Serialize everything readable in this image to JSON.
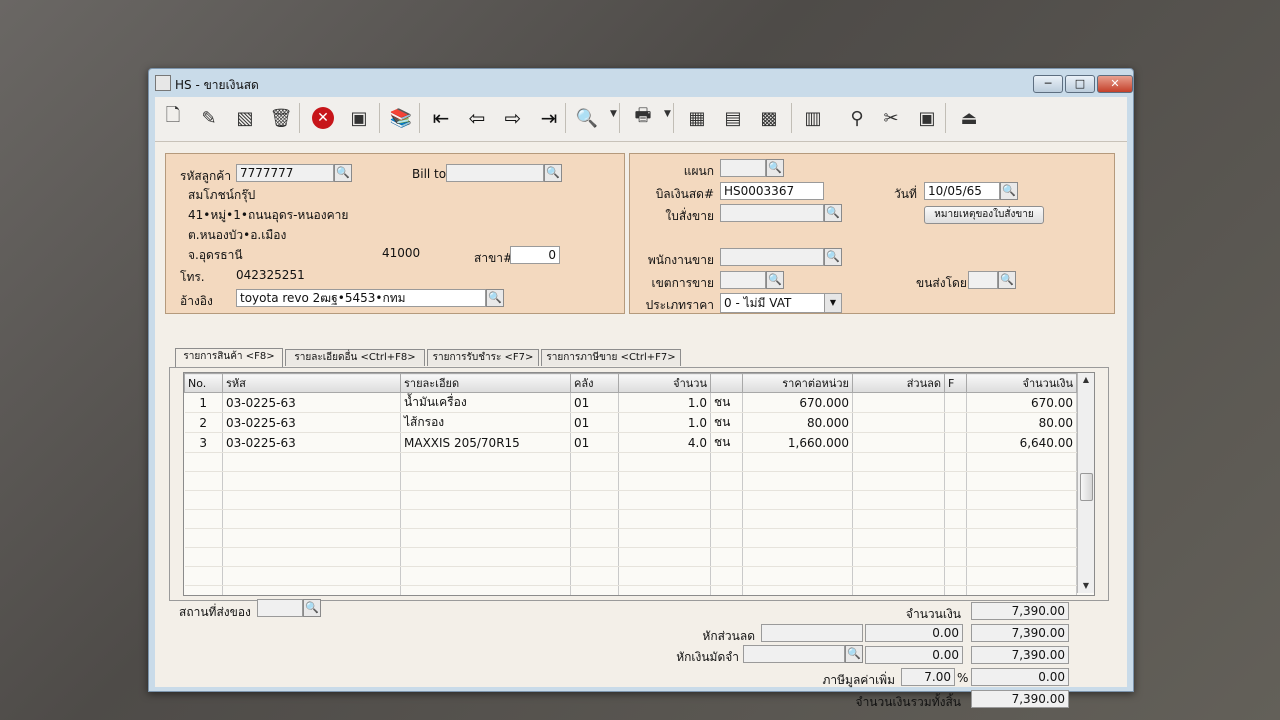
{
  "window": {
    "title": "HS - ขายเงินสด",
    "min_label": "─",
    "max_label": "□",
    "close_label": "✕"
  },
  "toolbar": {
    "buttons": [
      {
        "name": "new-icon",
        "glyph": "🗋"
      },
      {
        "name": "edit-icon",
        "glyph": "✎"
      },
      {
        "name": "cancel-doc-icon",
        "glyph": "▧"
      },
      {
        "name": "delete-icon",
        "glyph": "🗑"
      },
      {
        "name": "stop-icon",
        "glyph": "✕"
      },
      {
        "name": "save-icon",
        "glyph": "▣"
      },
      {
        "name": "book-icon",
        "glyph": "📚"
      },
      {
        "name": "first-record-icon",
        "glyph": "⇤"
      },
      {
        "name": "previous-record-icon",
        "glyph": "⇦"
      },
      {
        "name": "next-record-icon",
        "glyph": "⇨"
      },
      {
        "name": "last-record-icon",
        "glyph": "⇥"
      },
      {
        "name": "preview-icon",
        "glyph": "🔍"
      },
      {
        "name": "print-icon",
        "glyph": "🖶"
      },
      {
        "name": "calculator-icon",
        "glyph": "▦"
      },
      {
        "name": "report-icon",
        "glyph": "▤"
      },
      {
        "name": "spreadsheet-icon",
        "glyph": "▩"
      },
      {
        "name": "calendar-icon",
        "glyph": "▥"
      },
      {
        "name": "approve-icon",
        "glyph": "⚲"
      },
      {
        "name": "tools-icon",
        "glyph": "✂"
      },
      {
        "name": "ok-icon",
        "glyph": "▣"
      },
      {
        "name": "exit-icon",
        "glyph": "⏏"
      }
    ]
  },
  "customer": {
    "code_label": "รหัสลูกค้า",
    "code": "7777777",
    "bill_to_label": "Bill to",
    "bill_to": "",
    "name": "สมโภชน์กรุ๊ป",
    "address1": "41•หมู่•1•ถนนอุดร-หนองคาย",
    "address2": "ต.หนองบัว•อ.เมือง",
    "province": "จ.อุดรธานี",
    "postcode": "41000",
    "branch_label": "สาขา#",
    "branch": "0",
    "phone_label": "โทร.",
    "phone": "042325251",
    "ref_label": "อ้างอิง",
    "ref": "toyota revo 2ฒฐ•5453•กทม"
  },
  "document": {
    "dept_label": "แผนก",
    "dept": "",
    "bill_label": "บิลเงินสด#",
    "bill": "HS0003367",
    "date_label": "วันที่",
    "date": "10/05/65",
    "so_label": "ใบสั่งขาย",
    "so": "",
    "so_note_button": "หมายเหตุของใบสั่งขาย",
    "salesman_label": "พนักงานขาย",
    "salesman": "",
    "area_label": "เขตการขาย",
    "area": "",
    "ship_by_label": "ขนส่งโดย",
    "ship_by": "",
    "price_type_label": "ประเภทราคา",
    "price_type": "0 - ไม่มี VAT"
  },
  "tabs": [
    {
      "label": "รายการสินค้า <F8>"
    },
    {
      "label": "รายละเอียดอื่น <Ctrl+F8>"
    },
    {
      "label": "รายการรับชำระ <F7>"
    },
    {
      "label": "รายการภาษีขาย <Ctrl+F7>"
    }
  ],
  "grid": {
    "headers": [
      "No.",
      "รหัส",
      "รายละเอียด",
      "คลัง",
      "จำนวน",
      "",
      "ราคาต่อหน่วย",
      "ส่วนลด",
      "F",
      "จำนวนเงิน"
    ],
    "rows": [
      [
        "1",
        "03-0225-63",
        "น้ำมันเครื่อง",
        "01",
        "1.0",
        "ชน",
        "670.000",
        "",
        "",
        "670.00"
      ],
      [
        "2",
        "03-0225-63",
        "ไส้กรอง",
        "01",
        "1.0",
        "ชน",
        "80.000",
        "",
        "",
        "80.00"
      ],
      [
        "3",
        "03-0225-63",
        "MAXXIS 205/70R15",
        "01",
        "4.0",
        "ชน",
        "1,660.000",
        "",
        "",
        "6,640.00"
      ]
    ],
    "empty_rows": 8
  },
  "footer": {
    "ship_place_label": "สถานที่ส่งของ",
    "ship_place": "",
    "amount_label": "จำนวนเงิน",
    "amount": "7,390.00",
    "discount_label": "หักส่วนลด",
    "discount_text": "",
    "discount": "0.00",
    "after_discount": "7,390.00",
    "deposit_label": "หักเงินมัดจำ",
    "deposit_text": "",
    "deposit": "0.00",
    "after_deposit": "7,390.00",
    "vat_label": "ภาษีมูลค่าเพิ่ม",
    "vat_rate": "7.00",
    "vat_pct": "%",
    "vat": "0.00",
    "total_label": "จำนวนเงินรวมทั้งสิ้น",
    "total": "7,390.00"
  }
}
